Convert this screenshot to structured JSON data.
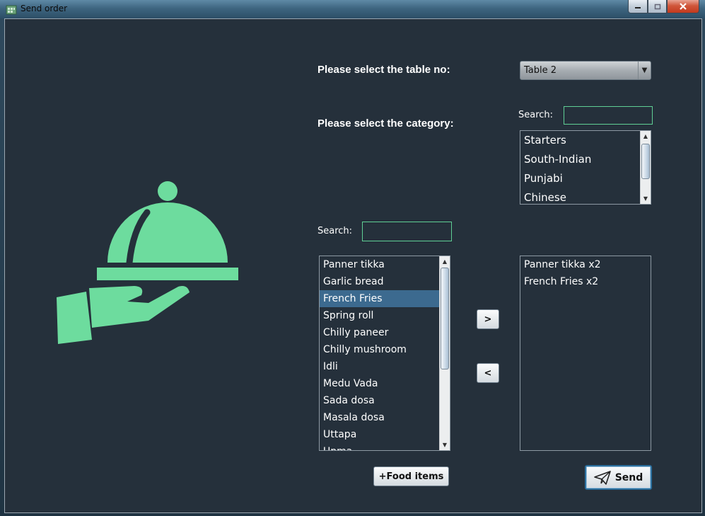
{
  "window": {
    "title": "Send order"
  },
  "table": {
    "label": "Please select the table no:",
    "selected": "Table 2"
  },
  "category": {
    "label": "Please select the category:",
    "search_label": "Search:",
    "search_value": "",
    "items": [
      "Starters",
      "South-Indian",
      "Punjabi",
      "Chinese"
    ]
  },
  "food": {
    "search_label": "Search:",
    "search_value": "",
    "items": [
      "Panner tikka",
      "Garlic bread",
      "French Fries",
      "Spring roll",
      "Chilly paneer",
      "Chilly mushroom",
      "Idli",
      "Medu Vada",
      "Sada dosa",
      "Masala dosa",
      "Uttapa",
      "Upma"
    ],
    "selected": "French Fries"
  },
  "order": {
    "items": [
      "Panner tikka x2",
      "French Fries x2"
    ]
  },
  "buttons": {
    "add": ">",
    "remove": "<",
    "food_items": "+Food items",
    "send": "Send"
  },
  "colors": {
    "accent": "#6ddc9e",
    "background": "#25303b",
    "selection": "#3c6a8f"
  },
  "icons": {
    "illustration": "serving-cloche-hand-icon",
    "send": "paper-plane-icon"
  }
}
